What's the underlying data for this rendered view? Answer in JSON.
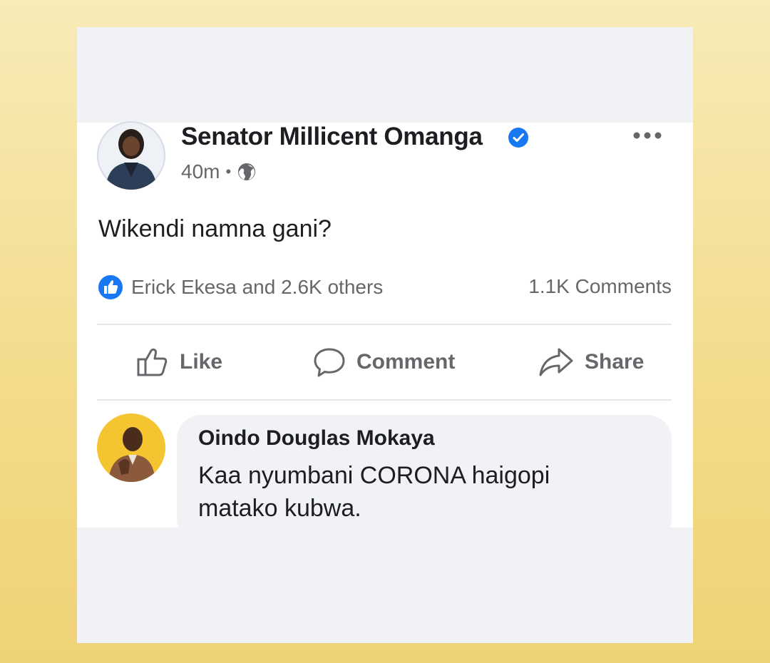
{
  "post": {
    "author": "Senator Millicent Omanga",
    "verified": true,
    "time": "40m",
    "privacy_icon": "globe-icon",
    "text": "Wikendi namna gani?",
    "reactions_text": "Erick Ekesa and 2.6K others",
    "comments_count": "1.1K Comments"
  },
  "actions": {
    "like": "Like",
    "comment": "Comment",
    "share": "Share"
  },
  "comment": {
    "author": "Oindo Douglas Mokaya",
    "text": "Kaa nyumbani CORONA haigopi matako kubwa."
  },
  "colors": {
    "brand_blue": "#1877f2",
    "text_primary": "#1c1e21",
    "text_secondary": "#65676b",
    "background_gradient_top": "#f7ebb8",
    "background_gradient_bottom": "#f0d276"
  }
}
